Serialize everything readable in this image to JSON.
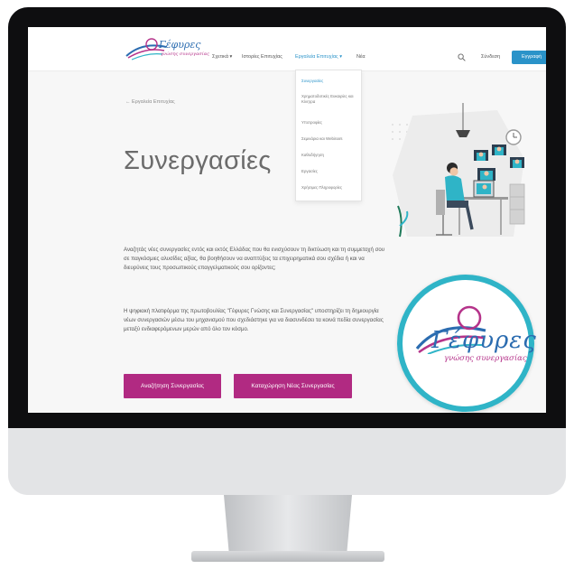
{
  "brand": {
    "name": "Γέφυρες",
    "tagline": "γνώσης συνεργασίας"
  },
  "nav": {
    "items": [
      "Σχετικά ▾",
      "Ιστορίες Επιτυχίας",
      "Εργαλεία Επιτυχίας ▾",
      "Νέα"
    ],
    "login": "Σύνδεση",
    "register": "Εγγραφή"
  },
  "dropdown": {
    "items": [
      "Συνεργασίες",
      "Χρηματοδοτικές Ευκαιρίες και Κίνητρα",
      "Υποτροφίες",
      "Σεμινάρια και Webinars",
      "Καθοδήγηση",
      "Εργασίες",
      "Χρήσιμες Πληροφορίες"
    ]
  },
  "page": {
    "back_link": "← Εργαλεία Επιτυχίας",
    "title": "Συνεργασίες",
    "paragraph1": "Αναζητάς νέες συνεργασίες εντός και εκτός Ελλάδας που θα ενισχύσουν τη δικτύωση και τη συμμετοχή σου σε παγκόσμιες αλυσίδες αξίας, θα βοηθήσουν να αναπτύξεις τα επιχειρηματικά σου σχέδια ή και να διευρύνεις τους προσωπικούς επαγγελματικούς σου ορίζοντες;",
    "paragraph2": "Η ψηφιακή πλατφόρμα της πρωτοβουλίας \"Γέφυρες Γνώσης και Συνεργασίας\" υποστηρίζει τη δημιουργία νέων συνεργασιών μέσω του μηχανισμού που σχεδιάστηκε για να διασυνδέσει τα κοινά πεδία συνεργασίας μεταξύ ενδιαφερόμενων μερών από όλο τον κόσμο.",
    "button_search": "Αναζήτηση Συνεργασίας",
    "button_register": "Καταχώρηση Νέας Συνεργασίας"
  },
  "badge": {
    "name": "Γέφυρες",
    "tagline": "γνώσης συνεργασίας"
  },
  "colors": {
    "accent": "#2a93c9",
    "button": "#b12a82",
    "badge_ring": "#2fb4c7"
  }
}
